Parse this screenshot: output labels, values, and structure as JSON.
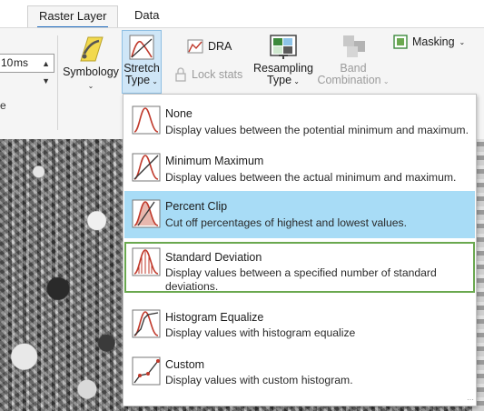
{
  "tabs": [
    {
      "label": "Raster Layer",
      "active": true
    },
    {
      "label": "Data",
      "active": false
    }
  ],
  "ribbon": {
    "number_box": {
      "value": "10",
      "unit": "ms"
    },
    "fragment_label": "e",
    "symbology": {
      "label": "Symbology"
    },
    "stretch_type": {
      "line1": "Stretch",
      "line2": "Type"
    },
    "dra": {
      "label": "DRA"
    },
    "lock_stats": {
      "label": "Lock stats"
    },
    "resampling": {
      "line1": "Resampling",
      "line2": "Type"
    },
    "band_combination": {
      "line1": "Band",
      "line2": "Combination"
    },
    "masking": {
      "label": "Masking"
    }
  },
  "menu": {
    "items": [
      {
        "title": "None",
        "description": "Display values between the potential minimum and maximum.",
        "icon": "stretch-none-icon"
      },
      {
        "title": "Minimum Maximum",
        "description": "Display values between the actual minimum and maximum.",
        "icon": "stretch-minmax-icon"
      },
      {
        "title": "Percent Clip",
        "description": "Cut off percentages of highest and lowest values.",
        "icon": "stretch-percent-clip-icon",
        "state": "hover"
      },
      {
        "title": "Standard Deviation",
        "description": "Display values between a specified number of standard deviations.",
        "icon": "stretch-std-dev-icon",
        "state": "selected"
      },
      {
        "title": "Histogram Equalize",
        "description": "Display values with histogram equalize",
        "icon": "stretch-histogram-equalize-icon"
      },
      {
        "title": "Custom",
        "description": "Display values with custom histogram.",
        "icon": "stretch-custom-icon"
      }
    ]
  },
  "colors": {
    "hover": "#a8dcf6",
    "selected_border": "#6aa84f",
    "active_tab_underline": "#1f6bbf",
    "icon_curve": "#c0392b"
  }
}
